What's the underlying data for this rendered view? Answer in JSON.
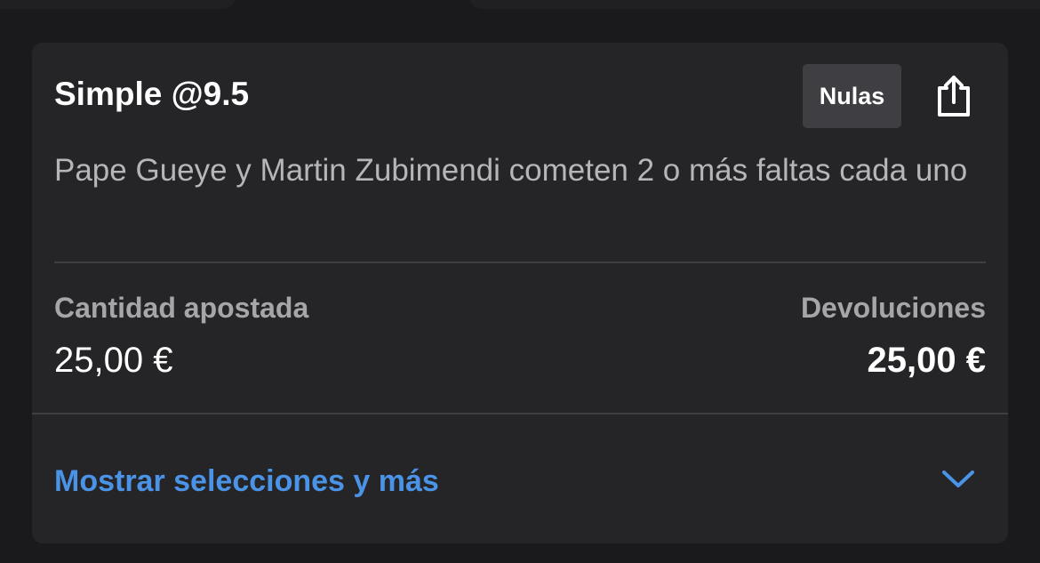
{
  "bet": {
    "title": "Simple @9.5",
    "status_badge": "Nulas",
    "description": "Pape Gueye y Martin Zubimendi cometen 2 o más faltas cada uno",
    "stake_label": "Cantidad apostada",
    "stake_value": "25,00 €",
    "returns_label": "Devoluciones",
    "returns_value": "25,00 €",
    "expand_label": "Mostrar selecciones y más"
  },
  "icons": {
    "share": "share-icon",
    "expand": "chevron-down-icon"
  },
  "colors": {
    "background": "#1a1a1c",
    "card": "#252527",
    "badge": "#3f3f43",
    "link": "#4a93e6",
    "muted_text": "#a5a5aa"
  }
}
